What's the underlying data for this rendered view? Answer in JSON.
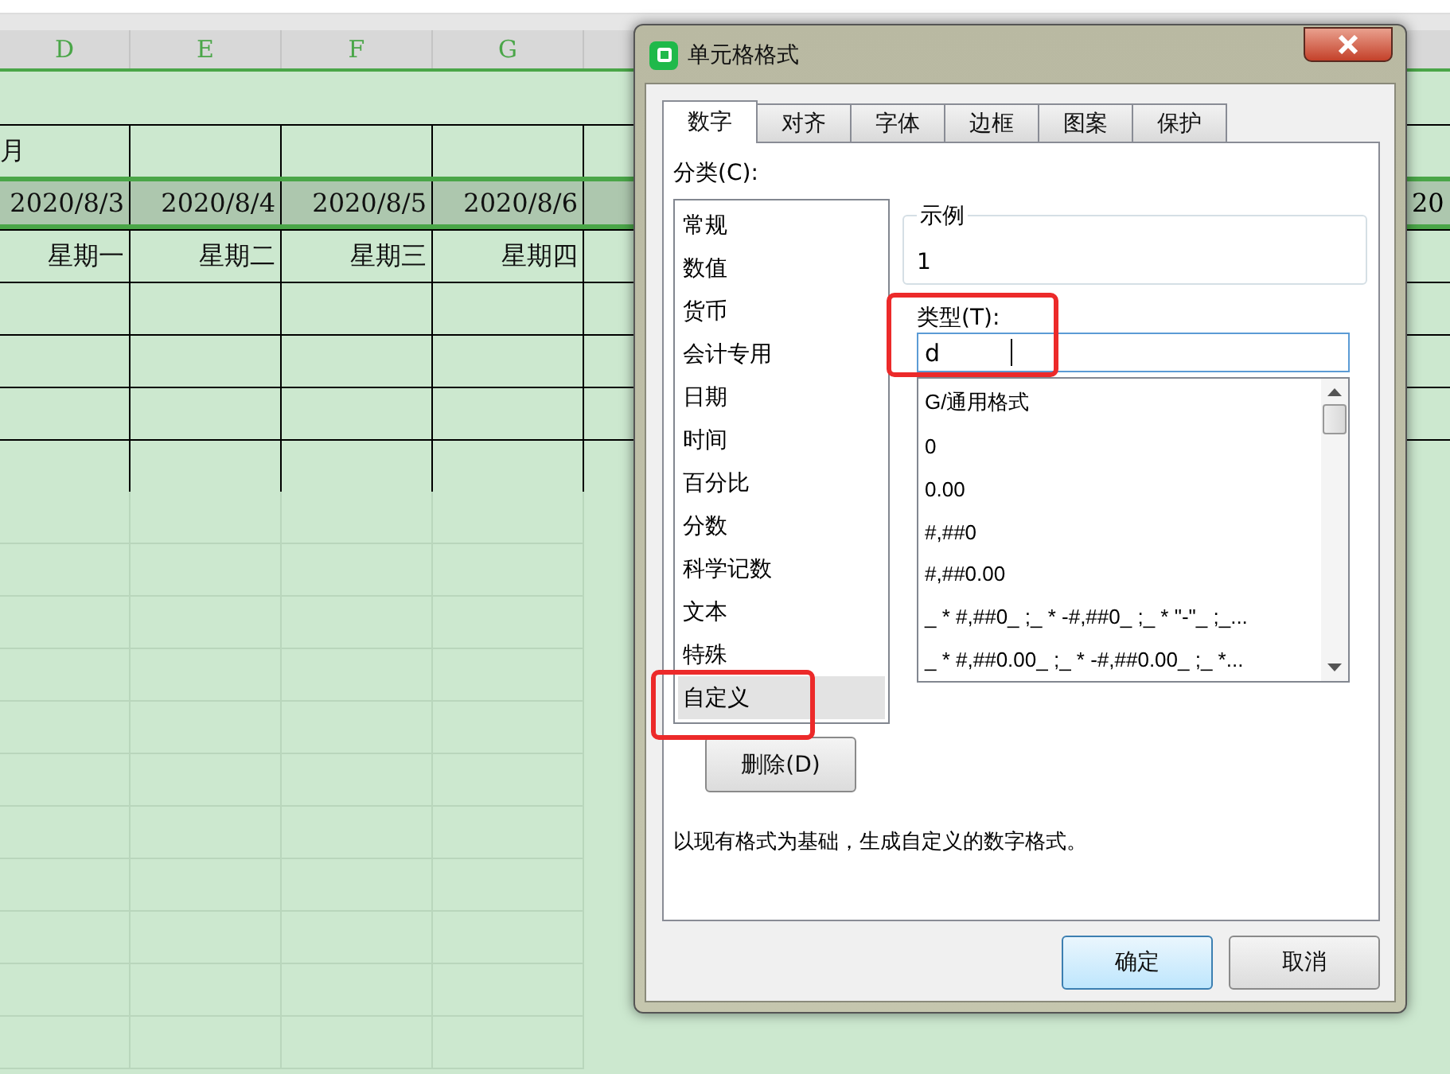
{
  "sheet": {
    "column_headers": [
      "D",
      "E",
      "F",
      "G"
    ],
    "month_label": "月",
    "date_row": {
      "selected": true,
      "cells": [
        "2020/8/3",
        "2020/8/4",
        "2020/8/5",
        "2020/8/6"
      ],
      "edge_cell": "20"
    },
    "weekdays": [
      "星期一",
      "星期二",
      "星期三",
      "星期四"
    ]
  },
  "dialog": {
    "title": "单元格格式",
    "tabs": [
      {
        "label": "数字",
        "selected": true
      },
      {
        "label": "对齐",
        "selected": false
      },
      {
        "label": "字体",
        "selected": false
      },
      {
        "label": "边框",
        "selected": false
      },
      {
        "label": "图案",
        "selected": false
      },
      {
        "label": "保护",
        "selected": false
      }
    ],
    "category_label": "分类(C):",
    "categories": [
      {
        "label": "常规",
        "selected": false
      },
      {
        "label": "数值",
        "selected": false
      },
      {
        "label": "货币",
        "selected": false
      },
      {
        "label": "会计专用",
        "selected": false
      },
      {
        "label": "日期",
        "selected": false
      },
      {
        "label": "时间",
        "selected": false
      },
      {
        "label": "百分比",
        "selected": false
      },
      {
        "label": "分数",
        "selected": false
      },
      {
        "label": "科学记数",
        "selected": false
      },
      {
        "label": "文本",
        "selected": false
      },
      {
        "label": "特殊",
        "selected": false
      },
      {
        "label": "自定义",
        "selected": true
      }
    ],
    "sample": {
      "label": "示例",
      "value": "1"
    },
    "type_label": "类型(T):",
    "type_value": "d",
    "formats": [
      "G/通用格式",
      "0",
      "0.00",
      "#,##0",
      "#,##0.00",
      "_ * #,##0_ ;_ * -#,##0_ ;_ * \"-\"_ ;_...",
      "_ * #,##0.00_ ;_ * -#,##0.00_ ;_ *..."
    ],
    "delete_button": "删除(D)",
    "description": "以现有格式为基础，生成自定义的数字格式。",
    "buttons": [
      {
        "label": "确定",
        "kind": "primary"
      },
      {
        "label": "取消",
        "kind": "secondary"
      }
    ]
  }
}
